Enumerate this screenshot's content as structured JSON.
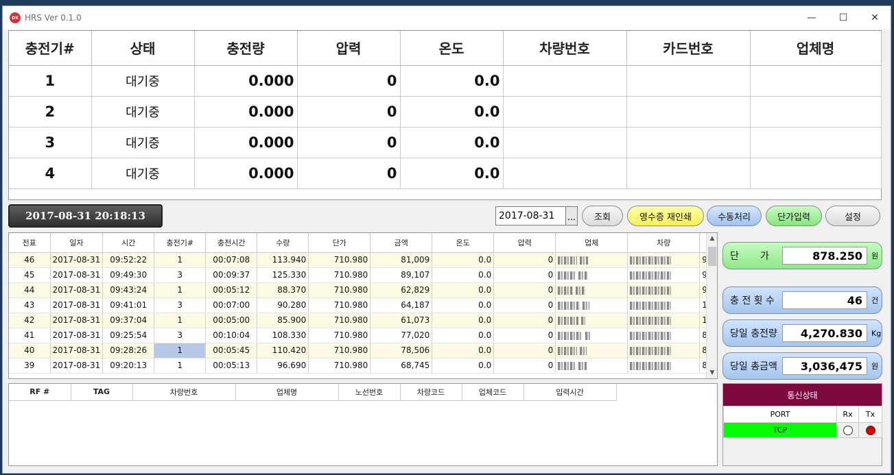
{
  "window": {
    "title": "HRS Ver 0.1.0",
    "icon_text": "DX",
    "minimize": "—",
    "maximize": "☐",
    "close": "✕"
  },
  "status": {
    "headers": [
      "충전기#",
      "상태",
      "충전량",
      "압력",
      "온도",
      "차량번호",
      "카드번호",
      "업체명"
    ],
    "rows": [
      {
        "no": "1",
        "state": "대기중",
        "amount": "0.000",
        "pressure": "0",
        "temp": "0.0",
        "car": "",
        "card": "",
        "company": ""
      },
      {
        "no": "2",
        "state": "대기중",
        "amount": "0.000",
        "pressure": "0",
        "temp": "0.0",
        "car": "",
        "card": "",
        "company": ""
      },
      {
        "no": "3",
        "state": "대기중",
        "amount": "0.000",
        "pressure": "0",
        "temp": "0.0",
        "car": "",
        "card": "",
        "company": ""
      },
      {
        "no": "4",
        "state": "대기중",
        "amount": "0.000",
        "pressure": "0",
        "temp": "0.0",
        "car": "",
        "card": "",
        "company": ""
      }
    ]
  },
  "toolbar": {
    "clock": "2017-08-31 20:18:13",
    "date": "2017-08-31",
    "date_picker": "...",
    "search": "조회",
    "reprint": "영수증 재인쇄",
    "manual": "수동처리",
    "price_input": "단가입력",
    "settings": "설정"
  },
  "ledger": {
    "headers": [
      "전표",
      "일자",
      "시간",
      "충전기#",
      "충전시간",
      "수량",
      "단가",
      "금액",
      "온도",
      "압력",
      "업체",
      "차량"
    ],
    "rows": [
      {
        "no": "46",
        "date": "2017-08-31",
        "time": "09:52:22",
        "charger": "1",
        "duration": "00:07:08",
        "qty": "113.940",
        "price": "710.980",
        "amount": "81,009",
        "temp": "0.0",
        "pressure": "0",
        "extra": "9"
      },
      {
        "no": "45",
        "date": "2017-08-31",
        "time": "09:49:30",
        "charger": "3",
        "duration": "00:09:37",
        "qty": "125.330",
        "price": "710.980",
        "amount": "89,107",
        "temp": "0.0",
        "pressure": "0",
        "extra": "9"
      },
      {
        "no": "44",
        "date": "2017-08-31",
        "time": "09:43:24",
        "charger": "1",
        "duration": "00:05:12",
        "qty": "88.370",
        "price": "710.980",
        "amount": "62,829",
        "temp": "0.0",
        "pressure": "0",
        "extra": "9"
      },
      {
        "no": "43",
        "date": "2017-08-31",
        "time": "09:41:01",
        "charger": "3",
        "duration": "00:07:00",
        "qty": "90.280",
        "price": "710.980",
        "amount": "64,187",
        "temp": "0.0",
        "pressure": "0",
        "extra": "1"
      },
      {
        "no": "42",
        "date": "2017-08-31",
        "time": "09:37:04",
        "charger": "1",
        "duration": "00:05:00",
        "qty": "85.900",
        "price": "710.980",
        "amount": "61,073",
        "temp": "0.0",
        "pressure": "0",
        "extra": "1"
      },
      {
        "no": "41",
        "date": "2017-08-31",
        "time": "09:25:54",
        "charger": "3",
        "duration": "00:10:04",
        "qty": "108.330",
        "price": "710.980",
        "amount": "77,020",
        "temp": "0.0",
        "pressure": "0",
        "extra": "8"
      },
      {
        "no": "40",
        "date": "2017-08-31",
        "time": "09:28:26",
        "charger": "1",
        "duration": "00:05:45",
        "qty": "110.420",
        "price": "710.980",
        "amount": "78,506",
        "temp": "0.0",
        "pressure": "0",
        "extra": "8"
      },
      {
        "no": "39",
        "date": "2017-08-31",
        "time": "09:20:13",
        "charger": "1",
        "duration": "00:05:13",
        "qty": "96.690",
        "price": "710.980",
        "amount": "68,745",
        "temp": "0.0",
        "pressure": "0",
        "extra": "8"
      }
    ]
  },
  "rf": {
    "headers": [
      "RF #",
      "TAG",
      "차량번호",
      "업체명",
      "노선번호",
      "차량코드",
      "업체코드",
      "입력시간"
    ]
  },
  "summary": {
    "unit_price": {
      "label": "단       가",
      "value": "878.250",
      "unit": "원"
    },
    "count": {
      "label": "충 전 횟 수",
      "value": "46",
      "unit": "건"
    },
    "daily_qty": {
      "label": "당일 충전량",
      "value": "4,270.830",
      "unit": "Kg"
    },
    "daily_total": {
      "label": "당일 총금액",
      "value": "3,036,475",
      "unit": "원"
    }
  },
  "comm": {
    "title": "통신상태",
    "headers": [
      "PORT",
      "Rx",
      "Tx"
    ],
    "port": "TCP",
    "colors": {
      "port_bg": "#00ff00",
      "rx": "#ffffff",
      "tx": "#e00000"
    }
  }
}
